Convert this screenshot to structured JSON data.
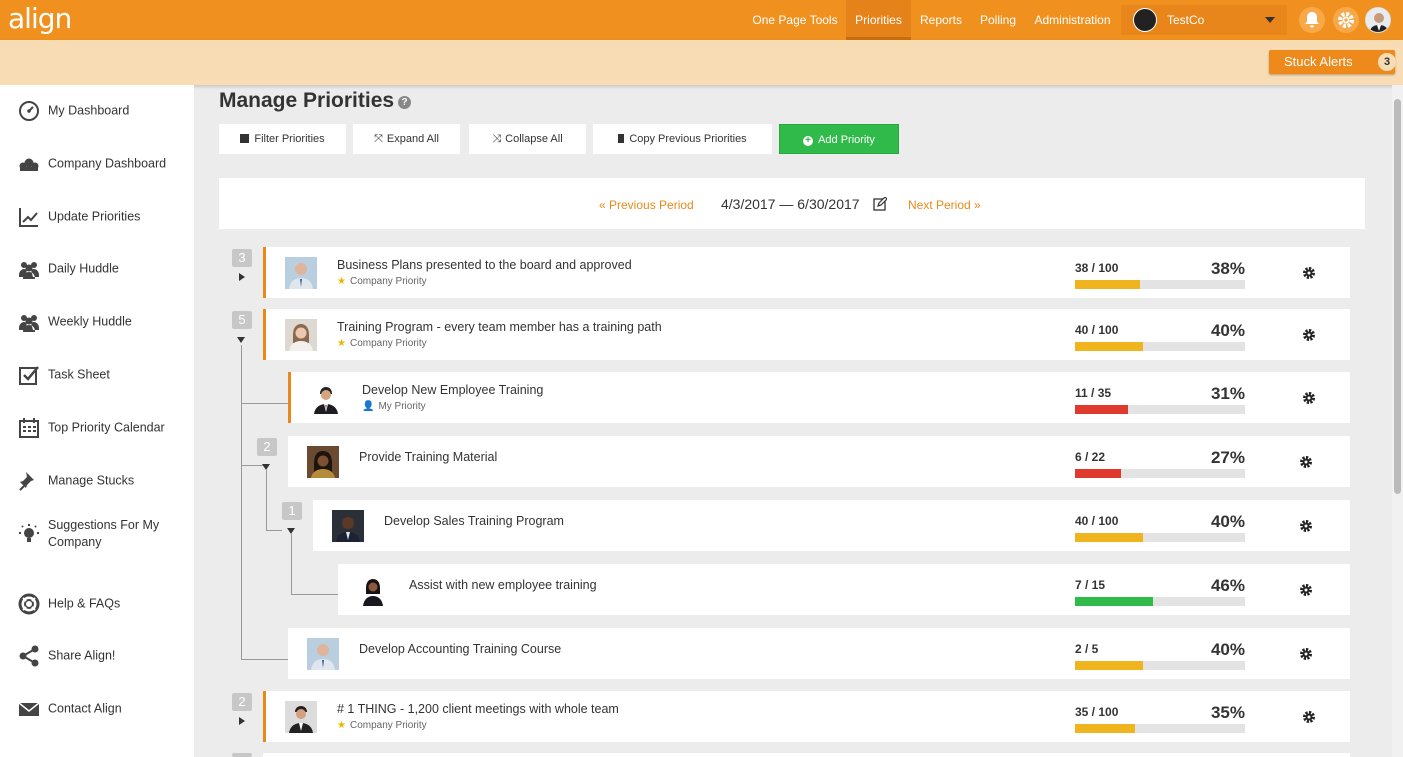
{
  "app": {
    "logo_text": "align"
  },
  "topnav": {
    "items": [
      "One Page Tools",
      "Priorities",
      "Reports",
      "Polling",
      "Administration"
    ],
    "active": "Priorities",
    "company": "TestCo"
  },
  "alerts": {
    "label": "Stuck Alerts",
    "count": "3"
  },
  "sidebar": {
    "items": [
      {
        "label": "My Dashboard",
        "icon": "dashboard-icon"
      },
      {
        "label": "Company Dashboard",
        "icon": "company-icon"
      },
      {
        "label": "Update Priorities",
        "icon": "chart-icon"
      },
      {
        "label": "Daily Huddle",
        "icon": "group-icon"
      },
      {
        "label": "Weekly Huddle",
        "icon": "group-icon"
      },
      {
        "label": "Task Sheet",
        "icon": "checkbox-icon"
      },
      {
        "label": "Top Priority Calendar",
        "icon": "calendar-icon"
      },
      {
        "label": "Manage Stucks",
        "icon": "pin-icon"
      },
      {
        "label": "Suggestions For My Company",
        "icon": "lightbulb-icon"
      },
      {
        "label": "Help & FAQs",
        "icon": "lifebuoy-icon"
      },
      {
        "label": "Share Align!",
        "icon": "share-icon"
      },
      {
        "label": "Contact Align",
        "icon": "envelope-icon"
      }
    ]
  },
  "page": {
    "title": "Manage Priorities",
    "help": "?"
  },
  "toolbar": {
    "filter": "Filter Priorities",
    "expand": "Expand All",
    "collapse": "Collapse All",
    "copy": "Copy Previous Priorities",
    "add": "Add Priority"
  },
  "period": {
    "prev": "« Previous Period",
    "range": "4/3/2017 — 6/30/2017",
    "next": "Next Period »"
  },
  "priorities": [
    {
      "title": "Business Plans presented to the board and approved",
      "sub": "Company Priority",
      "count": "38 / 100",
      "pct": "38%",
      "progress": 0.38,
      "color": "#f0b41e",
      "badge": "3"
    },
    {
      "title": "Training Program - every team member has a training path",
      "sub": "Company Priority",
      "count": "40 / 100",
      "pct": "40%",
      "progress": 0.4,
      "color": "#f0b41e",
      "badge": "5"
    },
    {
      "title": "Develop New Employee Training",
      "sub": "My Priority",
      "count": "11 / 35",
      "pct": "31%",
      "progress": 0.31,
      "color": "#e03a2e"
    },
    {
      "title": "Provide Training Material",
      "count": "6 / 22",
      "pct": "27%",
      "progress": 0.27,
      "color": "#e03a2e",
      "badge": "2"
    },
    {
      "title": "Develop Sales Training Program",
      "count": "40 / 100",
      "pct": "40%",
      "progress": 0.4,
      "color": "#f0b41e",
      "badge": "1"
    },
    {
      "title": "Assist with new employee training",
      "count": "7 / 15",
      "pct": "46%",
      "progress": 0.46,
      "color": "#2fba4a"
    },
    {
      "title": "Develop Accounting Training Course",
      "count": "2 / 5",
      "pct": "40%",
      "progress": 0.4,
      "color": "#f0b41e"
    },
    {
      "title": "# 1 THING - 1,200 client meetings with whole team",
      "sub": "Company Priority",
      "count": "35 / 100",
      "pct": "35%",
      "progress": 0.35,
      "color": "#f0b41e",
      "badge": "2"
    }
  ]
}
